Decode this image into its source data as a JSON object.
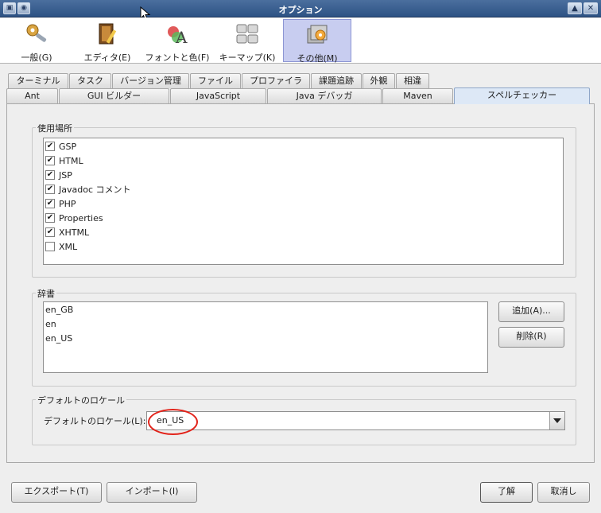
{
  "window": {
    "title": "オプション"
  },
  "categories": [
    {
      "label": "一般(G)",
      "icon": "general-settings-icon",
      "selected": false
    },
    {
      "label": "エディタ(E)",
      "icon": "editor-icon",
      "selected": false
    },
    {
      "label": "フォントと色(F)",
      "icon": "fonts-colors-icon",
      "selected": false
    },
    {
      "label": "キーマップ(K)",
      "icon": "keymap-icon",
      "selected": false
    },
    {
      "label": "その他(M)",
      "icon": "miscellaneous-icon",
      "selected": true
    }
  ],
  "tabs_top": [
    "ターミナル",
    "タスク",
    "バージョン管理",
    "ファイル",
    "プロファイラ",
    "課題追跡",
    "外観",
    "相違"
  ],
  "tabs_bottom": [
    "Ant",
    "GUI ビルダー",
    "JavaScript",
    "Java デバッガ",
    "Maven",
    "スペルチェッカー"
  ],
  "active_tab": "スペルチェッカー",
  "usage": {
    "legend": "使用場所",
    "items": [
      {
        "label": "GSP",
        "checked": true
      },
      {
        "label": "HTML",
        "checked": true
      },
      {
        "label": "JSP",
        "checked": true
      },
      {
        "label": "Javadoc コメント",
        "checked": true
      },
      {
        "label": "PHP",
        "checked": true
      },
      {
        "label": "Properties",
        "checked": true
      },
      {
        "label": "XHTML",
        "checked": true
      },
      {
        "label": "XML",
        "checked": false
      }
    ]
  },
  "dictionary": {
    "legend": "辞書",
    "items": [
      "en_GB",
      "en",
      "en_US"
    ],
    "add_label": "追加(A)...",
    "remove_label": "削除(R)"
  },
  "locale": {
    "legend": "デフォルトのロケール",
    "label": "デフォルトのロケール(L):",
    "value": "en_US"
  },
  "footer": {
    "export_label": "エクスポート(T)",
    "import_label": "インポート(I)",
    "ok_label": "了解",
    "cancel_label": "取消し"
  },
  "colors": {
    "annotation": "#e2231a",
    "selected_category": "#c8cdf0",
    "titlebar": "#2d5284"
  }
}
